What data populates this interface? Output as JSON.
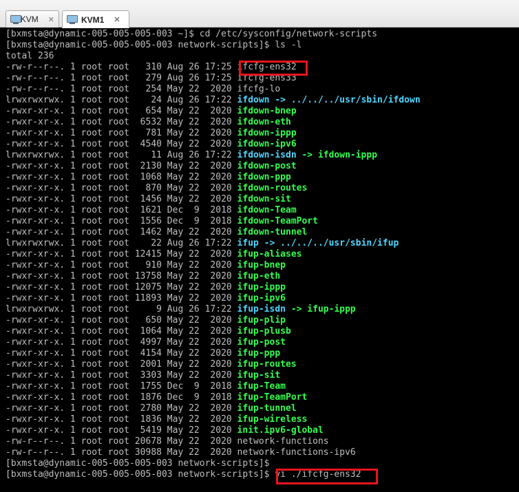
{
  "tabs": [
    {
      "label": "KVM",
      "active": false,
      "icon": "vm-monitor-icon"
    },
    {
      "label": "KVM1",
      "active": true,
      "icon": "vm-monitor-icon"
    }
  ],
  "colors": {
    "background": "#000000",
    "text": "#bfbfbf",
    "link": "#4fd6ff",
    "executable": "#33ff4f",
    "highlight": "#e8141c"
  },
  "terminal": {
    "lines": [
      {
        "text": "[bxmsta@dynamic-005-005-005-003 ~]$ cd /etc/sysconfig/network-scripts"
      },
      {
        "text": "[bxmsta@dynamic-005-005-005-003 network-scripts]$ ls -l"
      },
      {
        "text": "total 236"
      },
      {
        "prefix": "-rw-r--r--. 1 root root   310 Aug 26 17:25 ",
        "name": "ifcfg-ens32",
        "type": "file"
      },
      {
        "prefix": "-rw-r--r--. 1 root root   279 Aug 26 17:25 ",
        "name": "ifcfg-ens33",
        "type": "file"
      },
      {
        "prefix": "-rw-r--r--. 1 root root   254 May 22  2020 ",
        "name": "ifcfg-lo",
        "type": "file"
      },
      {
        "prefix": "lrwxrwxrwx. 1 root root    24 Aug 26 17:22 ",
        "name": "ifdown",
        "type": "link",
        "target": " -> ../../../usr/sbin/ifdown",
        "target_type": "link"
      },
      {
        "prefix": "-rwxr-xr-x. 1 root root   654 May 22  2020 ",
        "name": "ifdown-bnep",
        "type": "exec"
      },
      {
        "prefix": "-rwxr-xr-x. 1 root root  6532 May 22  2020 ",
        "name": "ifdown-eth",
        "type": "exec"
      },
      {
        "prefix": "-rwxr-xr-x. 1 root root   781 May 22  2020 ",
        "name": "ifdown-ippp",
        "type": "exec"
      },
      {
        "prefix": "-rwxr-xr-x. 1 root root  4540 May 22  2020 ",
        "name": "ifdown-ipv6",
        "type": "exec"
      },
      {
        "prefix": "lrwxrwxrwx. 1 root root    11 Aug 26 17:22 ",
        "name": "ifdown-isdn",
        "type": "link",
        "target": " -> ifdown-ippp",
        "target_type": "exec"
      },
      {
        "prefix": "-rwxr-xr-x. 1 root root  2130 May 22  2020 ",
        "name": "ifdown-post",
        "type": "exec"
      },
      {
        "prefix": "-rwxr-xr-x. 1 root root  1068 May 22  2020 ",
        "name": "ifdown-ppp",
        "type": "exec"
      },
      {
        "prefix": "-rwxr-xr-x. 1 root root   870 May 22  2020 ",
        "name": "ifdown-routes",
        "type": "exec"
      },
      {
        "prefix": "-rwxr-xr-x. 1 root root  1456 May 22  2020 ",
        "name": "ifdown-sit",
        "type": "exec"
      },
      {
        "prefix": "-rwxr-xr-x. 1 root root  1621 Dec  9  2018 ",
        "name": "ifdown-Team",
        "type": "exec"
      },
      {
        "prefix": "-rwxr-xr-x. 1 root root  1556 Dec  9  2018 ",
        "name": "ifdown-TeamPort",
        "type": "exec"
      },
      {
        "prefix": "-rwxr-xr-x. 1 root root  1462 May 22  2020 ",
        "name": "ifdown-tunnel",
        "type": "exec"
      },
      {
        "prefix": "lrwxrwxrwx. 1 root root    22 Aug 26 17:22 ",
        "name": "ifup",
        "type": "link",
        "target": " -> ../../../usr/sbin/ifup",
        "target_type": "link"
      },
      {
        "prefix": "-rwxr-xr-x. 1 root root 12415 May 22  2020 ",
        "name": "ifup-aliases",
        "type": "exec"
      },
      {
        "prefix": "-rwxr-xr-x. 1 root root   910 May 22  2020 ",
        "name": "ifup-bnep",
        "type": "exec"
      },
      {
        "prefix": "-rwxr-xr-x. 1 root root 13758 May 22  2020 ",
        "name": "ifup-eth",
        "type": "exec"
      },
      {
        "prefix": "-rwxr-xr-x. 1 root root 12075 May 22  2020 ",
        "name": "ifup-ippp",
        "type": "exec"
      },
      {
        "prefix": "-rwxr-xr-x. 1 root root 11893 May 22  2020 ",
        "name": "ifup-ipv6",
        "type": "exec"
      },
      {
        "prefix": "lrwxrwxrwx. 1 root root     9 Aug 26 17:22 ",
        "name": "ifup-isdn",
        "type": "link",
        "target": " -> ifup-ippp",
        "target_type": "exec"
      },
      {
        "prefix": "-rwxr-xr-x. 1 root root   650 May 22  2020 ",
        "name": "ifup-plip",
        "type": "exec"
      },
      {
        "prefix": "-rwxr-xr-x. 1 root root  1064 May 22  2020 ",
        "name": "ifup-plusb",
        "type": "exec"
      },
      {
        "prefix": "-rwxr-xr-x. 1 root root  4997 May 22  2020 ",
        "name": "ifup-post",
        "type": "exec"
      },
      {
        "prefix": "-rwxr-xr-x. 1 root root  4154 May 22  2020 ",
        "name": "ifup-ppp",
        "type": "exec"
      },
      {
        "prefix": "-rwxr-xr-x. 1 root root  2001 May 22  2020 ",
        "name": "ifup-routes",
        "type": "exec"
      },
      {
        "prefix": "-rwxr-xr-x. 1 root root  3303 May 22  2020 ",
        "name": "ifup-sit",
        "type": "exec"
      },
      {
        "prefix": "-rwxr-xr-x. 1 root root  1755 Dec  9  2018 ",
        "name": "ifup-Team",
        "type": "exec"
      },
      {
        "prefix": "-rwxr-xr-x. 1 root root  1876 Dec  9  2018 ",
        "name": "ifup-TeamPort",
        "type": "exec"
      },
      {
        "prefix": "-rwxr-xr-x. 1 root root  2780 May 22  2020 ",
        "name": "ifup-tunnel",
        "type": "exec"
      },
      {
        "prefix": "-rwxr-xr-x. 1 root root  1836 May 22  2020 ",
        "name": "ifup-wireless",
        "type": "exec"
      },
      {
        "prefix": "-rwxr-xr-x. 1 root root  5419 May 22  2020 ",
        "name": "init.ipv6-global",
        "type": "exec"
      },
      {
        "prefix": "-rw-r--r--. 1 root root 20678 May 22  2020 ",
        "name": "network-functions",
        "type": "file"
      },
      {
        "prefix": "-rw-r--r--. 1 root root 30988 May 22  2020 ",
        "name": "network-functions-ipv6",
        "type": "file"
      },
      {
        "text": "[bxmsta@dynamic-005-005-005-003 network-scripts]$"
      },
      {
        "text": "[bxmsta@dynamic-005-005-005-003 network-scripts]$ vi ./ifcfg-ens32"
      }
    ]
  }
}
